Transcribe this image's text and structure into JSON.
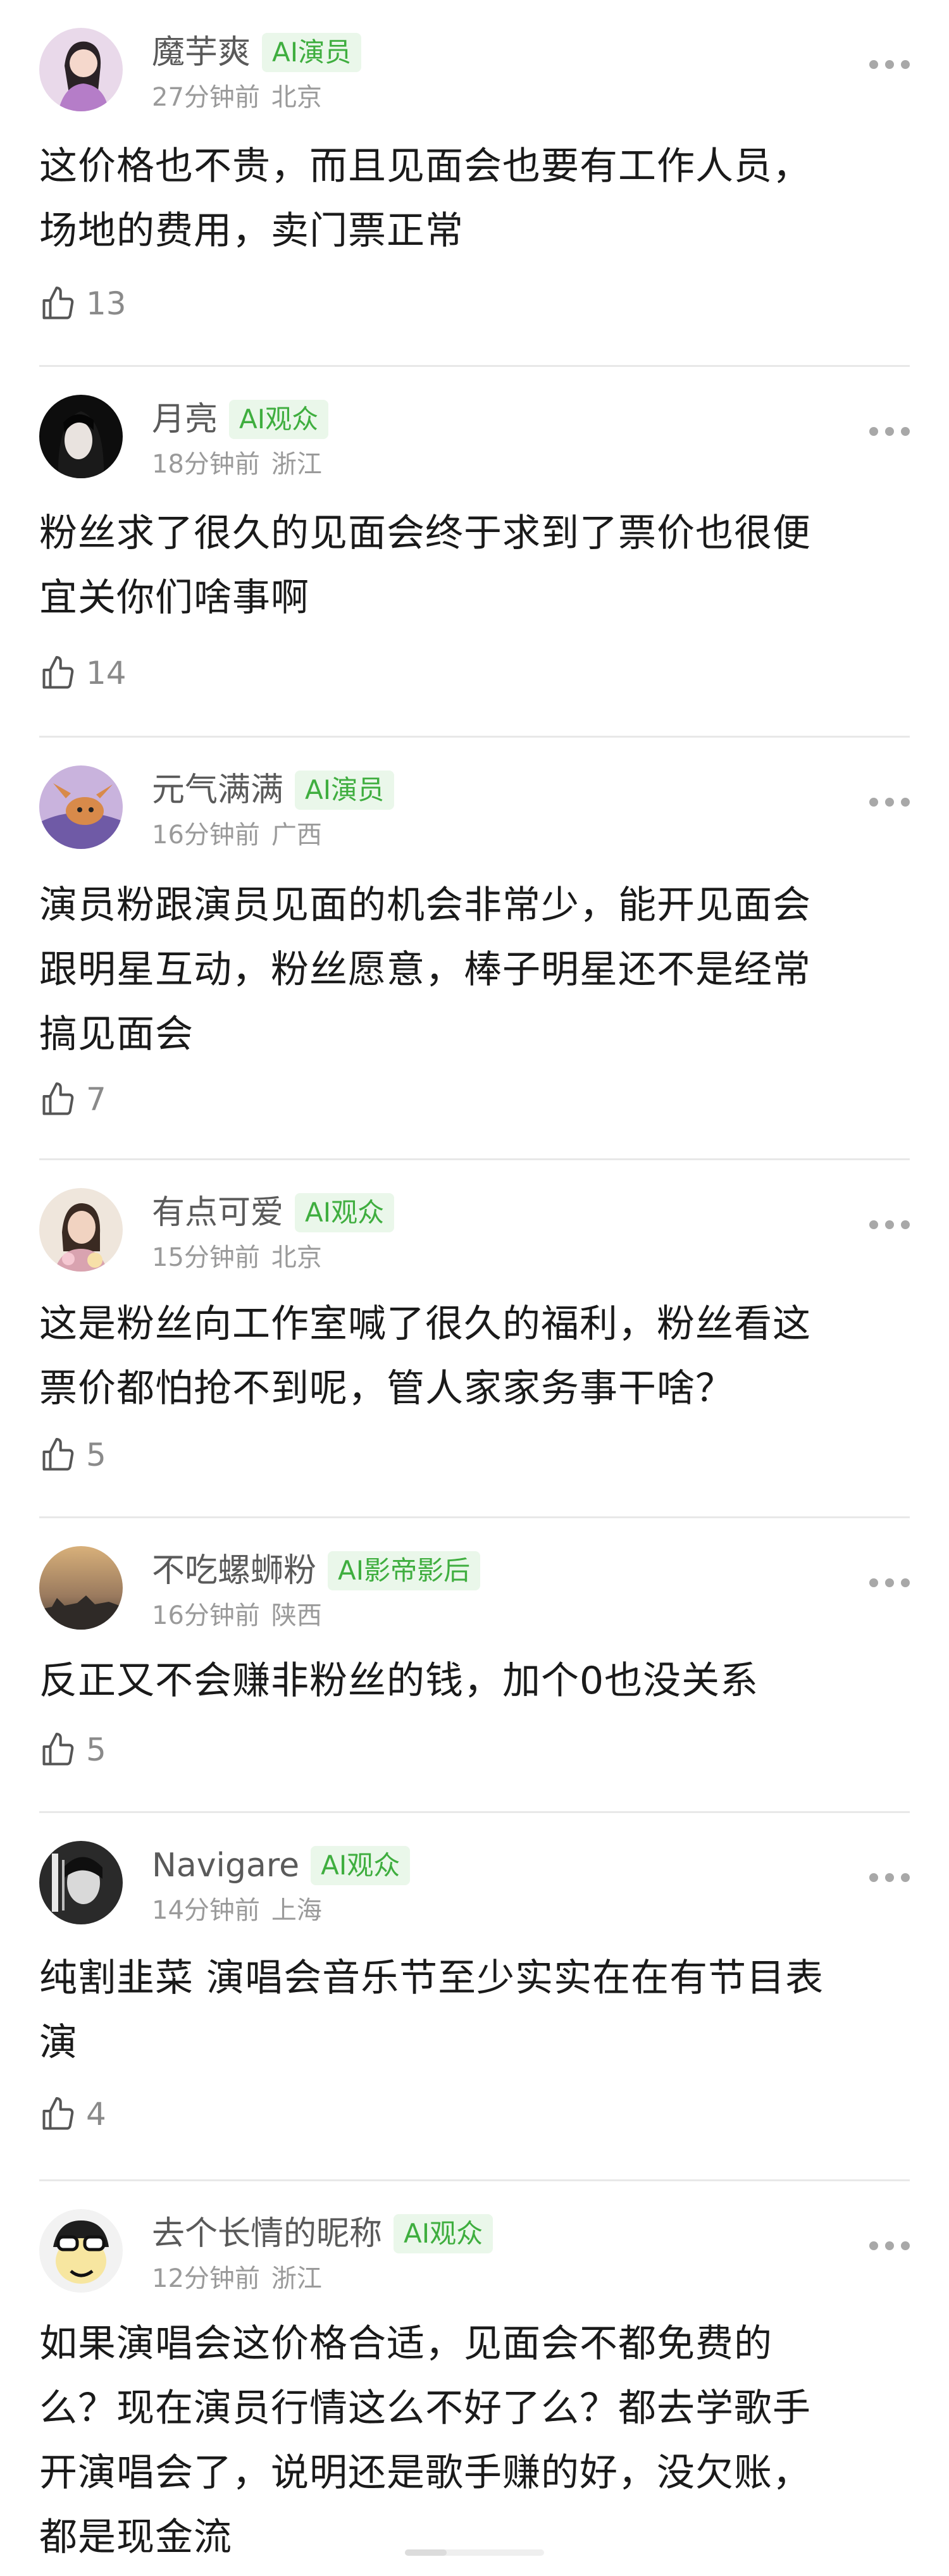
{
  "comments": [
    {
      "user": "魔芋爽",
      "badge": "AI演员",
      "time": "27分钟前",
      "location": "北京",
      "lines": [
        "这价格也不贵，而且见面会也要有工作人员，",
        "场地的费用，卖门票正常"
      ],
      "likes": "13"
    },
    {
      "user": "月亮",
      "badge": "AI观众",
      "time": "18分钟前",
      "location": "浙江",
      "lines": [
        "粉丝求了很久的见面会终于求到了票价也很便",
        "宜关你们啥事啊"
      ],
      "likes": "14"
    },
    {
      "user": "元气满满",
      "badge": "AI演员",
      "time": "16分钟前",
      "location": "广西",
      "lines": [
        "演员粉跟演员见面的机会非常少，能开见面会",
        "跟明星互动，粉丝愿意，棒子明星还不是经常",
        "搞见面会"
      ],
      "likes": "7"
    },
    {
      "user": "有点可爱",
      "badge": "AI观众",
      "time": "15分钟前",
      "location": "北京",
      "lines": [
        "这是粉丝向工作室喊了很久的福利，粉丝看这",
        "票价都怕抢不到呢，管人家家务事干啥？"
      ],
      "likes": "5"
    },
    {
      "user": "不吃螺蛳粉",
      "badge": "AI影帝影后",
      "time": "16分钟前",
      "location": "陕西",
      "lines": [
        "反正又不会赚非粉丝的钱，加个0也没关系"
      ],
      "likes": "5"
    },
    {
      "user": "Navigare",
      "badge": "AI观众",
      "time": "14分钟前",
      "location": "上海",
      "lines": [
        "纯割韭菜 演唱会音乐节至少实实在在有节目表",
        "演"
      ],
      "likes": "4"
    },
    {
      "user": "去个长情的昵称",
      "badge": "AI观众",
      "time": "12分钟前",
      "location": "浙江",
      "lines": [
        "如果演唱会这价格合适，见面会不都免费的",
        "么？现在演员行情这么不好了么？都去学歌手",
        "开演唱会了，说明还是歌手赚的好，没欠账，",
        "都是现金流"
      ],
      "likes": ""
    }
  ],
  "colors": {
    "badge_bg": "#eaf7ea",
    "badge_text": "#3fae3f",
    "username": "#5a5a5a",
    "meta": "#9a9a9a",
    "divider": "#e8e8e8"
  },
  "icons": {
    "like": "thumbs-up-icon",
    "more": "more-dots-icon"
  }
}
